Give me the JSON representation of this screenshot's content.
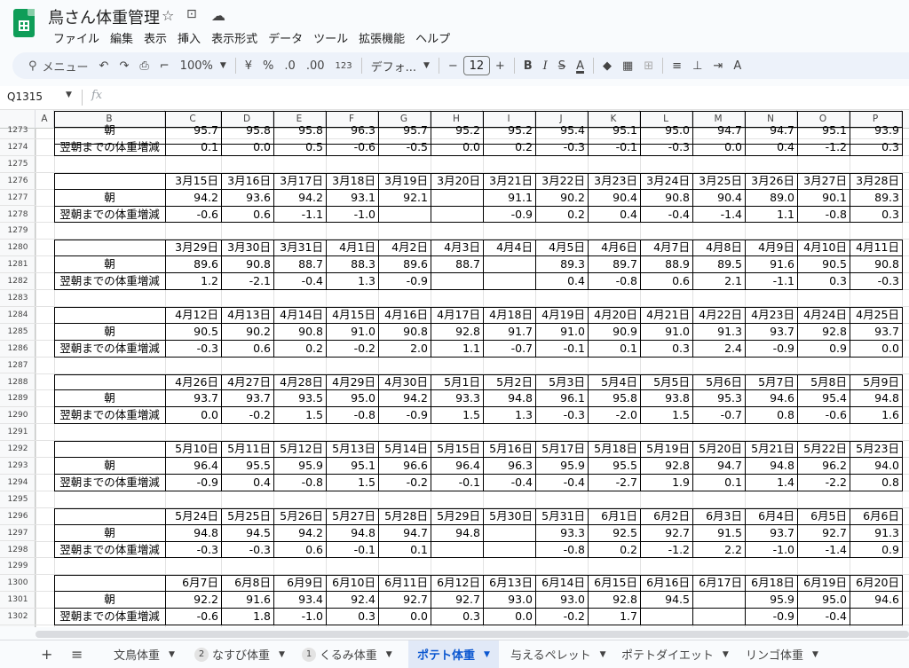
{
  "document": {
    "title": "鳥さん体重管理",
    "star_icon": "star-icon",
    "move_icon": "folder-move-icon",
    "cloud_icon": "cloud-saved-icon"
  },
  "menu": [
    "ファイル",
    "編集",
    "表示",
    "挿入",
    "表示形式",
    "データ",
    "ツール",
    "拡張機能",
    "ヘルプ"
  ],
  "toolbar": {
    "search_label": "メニュー",
    "zoom": "100%",
    "currency": "¥",
    "percent": "%",
    "dec_decrease": ".0",
    "dec_increase": ".00",
    "number_format": "123",
    "font_name": "デフォ...",
    "font_size": "12",
    "minus": "−",
    "plus": "+",
    "bold": "B",
    "italic": "I",
    "strike": "S",
    "text_color": "A"
  },
  "formula_bar": {
    "name_box": "Q1315",
    "fx": "fx",
    "content": ""
  },
  "columns": [
    "A",
    "B",
    "C",
    "D",
    "E",
    "F",
    "G",
    "H",
    "I",
    "J",
    "K",
    "L",
    "M",
    "N",
    "O",
    "P"
  ],
  "labels": {
    "morning": "朝",
    "change": "翌朝までの体重増減"
  },
  "partial_row": {
    "row_weight": "1273",
    "row_change": "1274",
    "weights": [
      "95.7",
      "95.8",
      "95.8",
      "96.3",
      "95.7",
      "95.2",
      "95.2",
      "95.4",
      "95.1",
      "95.0",
      "94.7",
      "94.7",
      "95.1",
      "93.9"
    ],
    "changes": [
      "0.1",
      "0.0",
      "0.5",
      "-0.6",
      "-0.5",
      "0.0",
      "0.2",
      "-0.3",
      "-0.1",
      "-0.3",
      "0.0",
      "0.4",
      "-1.2",
      "0.3"
    ]
  },
  "blocks": [
    {
      "rows": [
        "1275",
        "1276",
        "1277",
        "1278"
      ],
      "dates": [
        "3月15日",
        "3月16日",
        "3月17日",
        "3月18日",
        "3月19日",
        "3月20日",
        "3月21日",
        "3月22日",
        "3月23日",
        "3月24日",
        "3月25日",
        "3月26日",
        "3月27日",
        "3月28日"
      ],
      "weights": [
        "94.2",
        "93.6",
        "94.2",
        "93.1",
        "92.1",
        "",
        "91.1",
        "90.2",
        "90.4",
        "90.8",
        "90.4",
        "89.0",
        "90.1",
        "89.3"
      ],
      "changes": [
        "-0.6",
        "0.6",
        "-1.1",
        "-1.0",
        "",
        "",
        "-0.9",
        "0.2",
        "0.4",
        "-0.4",
        "-1.4",
        "1.1",
        "-0.8",
        "0.3"
      ]
    },
    {
      "rows": [
        "1279",
        "1280",
        "1281",
        "1282"
      ],
      "dates": [
        "3月29日",
        "3月30日",
        "3月31日",
        "4月1日",
        "4月2日",
        "4月3日",
        "4月4日",
        "4月5日",
        "4月6日",
        "4月7日",
        "4月8日",
        "4月9日",
        "4月10日",
        "4月11日"
      ],
      "weights": [
        "89.6",
        "90.8",
        "88.7",
        "88.3",
        "89.6",
        "88.7",
        "",
        "89.3",
        "89.7",
        "88.9",
        "89.5",
        "91.6",
        "90.5",
        "90.8"
      ],
      "changes": [
        "1.2",
        "-2.1",
        "-0.4",
        "1.3",
        "-0.9",
        "",
        "",
        "0.4",
        "-0.8",
        "0.6",
        "2.1",
        "-1.1",
        "0.3",
        "-0.3"
      ]
    },
    {
      "rows": [
        "1283",
        "1284",
        "1285",
        "1286"
      ],
      "dates": [
        "4月12日",
        "4月13日",
        "4月14日",
        "4月15日",
        "4月16日",
        "4月17日",
        "4月18日",
        "4月19日",
        "4月20日",
        "4月21日",
        "4月22日",
        "4月23日",
        "4月24日",
        "4月25日"
      ],
      "weights": [
        "90.5",
        "90.2",
        "90.8",
        "91.0",
        "90.8",
        "92.8",
        "91.7",
        "91.0",
        "90.9",
        "91.0",
        "91.3",
        "93.7",
        "92.8",
        "93.7"
      ],
      "changes": [
        "-0.3",
        "0.6",
        "0.2",
        "-0.2",
        "2.0",
        "1.1",
        "-0.7",
        "-0.1",
        "0.1",
        "0.3",
        "2.4",
        "-0.9",
        "0.9",
        "0.0"
      ]
    },
    {
      "rows": [
        "1287",
        "1288",
        "1289",
        "1290"
      ],
      "dates": [
        "4月26日",
        "4月27日",
        "4月28日",
        "4月29日",
        "4月30日",
        "5月1日",
        "5月2日",
        "5月3日",
        "5月4日",
        "5月5日",
        "5月6日",
        "5月7日",
        "5月8日",
        "5月9日"
      ],
      "weights": [
        "93.7",
        "93.7",
        "93.5",
        "95.0",
        "94.2",
        "93.3",
        "94.8",
        "96.1",
        "95.8",
        "93.8",
        "95.3",
        "94.6",
        "95.4",
        "94.8"
      ],
      "changes": [
        "0.0",
        "-0.2",
        "1.5",
        "-0.8",
        "-0.9",
        "1.5",
        "1.3",
        "-0.3",
        "-2.0",
        "1.5",
        "-0.7",
        "0.8",
        "-0.6",
        "1.6"
      ]
    },
    {
      "rows": [
        "1291",
        "1292",
        "1293",
        "1294"
      ],
      "dates": [
        "5月10日",
        "5月11日",
        "5月12日",
        "5月13日",
        "5月14日",
        "5月15日",
        "5月16日",
        "5月17日",
        "5月18日",
        "5月19日",
        "5月20日",
        "5月21日",
        "5月22日",
        "5月23日"
      ],
      "weights": [
        "96.4",
        "95.5",
        "95.9",
        "95.1",
        "96.6",
        "96.4",
        "96.3",
        "95.9",
        "95.5",
        "92.8",
        "94.7",
        "94.8",
        "96.2",
        "94.0"
      ],
      "changes": [
        "-0.9",
        "0.4",
        "-0.8",
        "1.5",
        "-0.2",
        "-0.1",
        "-0.4",
        "-0.4",
        "-2.7",
        "1.9",
        "0.1",
        "1.4",
        "-2.2",
        "0.8"
      ]
    },
    {
      "rows": [
        "1295",
        "1296",
        "1297",
        "1298"
      ],
      "dates": [
        "5月24日",
        "5月25日",
        "5月26日",
        "5月27日",
        "5月28日",
        "5月29日",
        "5月30日",
        "5月31日",
        "6月1日",
        "6月2日",
        "6月3日",
        "6月4日",
        "6月5日",
        "6月6日"
      ],
      "weights": [
        "94.8",
        "94.5",
        "94.2",
        "94.8",
        "94.7",
        "94.8",
        "",
        "93.3",
        "92.5",
        "92.7",
        "91.5",
        "93.7",
        "92.7",
        "91.3"
      ],
      "changes": [
        "-0.3",
        "-0.3",
        "0.6",
        "-0.1",
        "0.1",
        "",
        "",
        "-0.8",
        "0.2",
        "-1.2",
        "2.2",
        "-1.0",
        "-1.4",
        "0.9"
      ]
    },
    {
      "rows": [
        "1299",
        "1300",
        "1301",
        "1302"
      ],
      "dates": [
        "6月7日",
        "6月8日",
        "6月9日",
        "6月10日",
        "6月11日",
        "6月12日",
        "6月13日",
        "6月14日",
        "6月15日",
        "6月16日",
        "6月17日",
        "6月18日",
        "6月19日",
        "6月20日"
      ],
      "weights": [
        "92.2",
        "91.6",
        "93.4",
        "92.4",
        "92.7",
        "92.7",
        "93.0",
        "93.0",
        "92.8",
        "94.5",
        "",
        "95.9",
        "95.0",
        "94.6"
      ],
      "changes": [
        "-0.6",
        "1.8",
        "-1.0",
        "0.3",
        "0.0",
        "0.3",
        "0.0",
        "-0.2",
        "1.7",
        "",
        "",
        "-0.9",
        "-0.4",
        ""
      ]
    }
  ],
  "sheets": [
    {
      "label": "文鳥体重",
      "badge": ""
    },
    {
      "label": "なすび体重",
      "badge": "2"
    },
    {
      "label": "くるみ体重",
      "badge": "1"
    },
    {
      "label": "ポテト体重",
      "badge": "",
      "active": true
    },
    {
      "label": "与えるペレット",
      "badge": ""
    },
    {
      "label": "ポテトダイエット",
      "badge": ""
    },
    {
      "label": "リンゴ体重",
      "badge": ""
    }
  ],
  "colors": {
    "accent": "#0b57d0",
    "active_tab_bg": "#e1e9f7",
    "logo": "#0f9d58"
  }
}
